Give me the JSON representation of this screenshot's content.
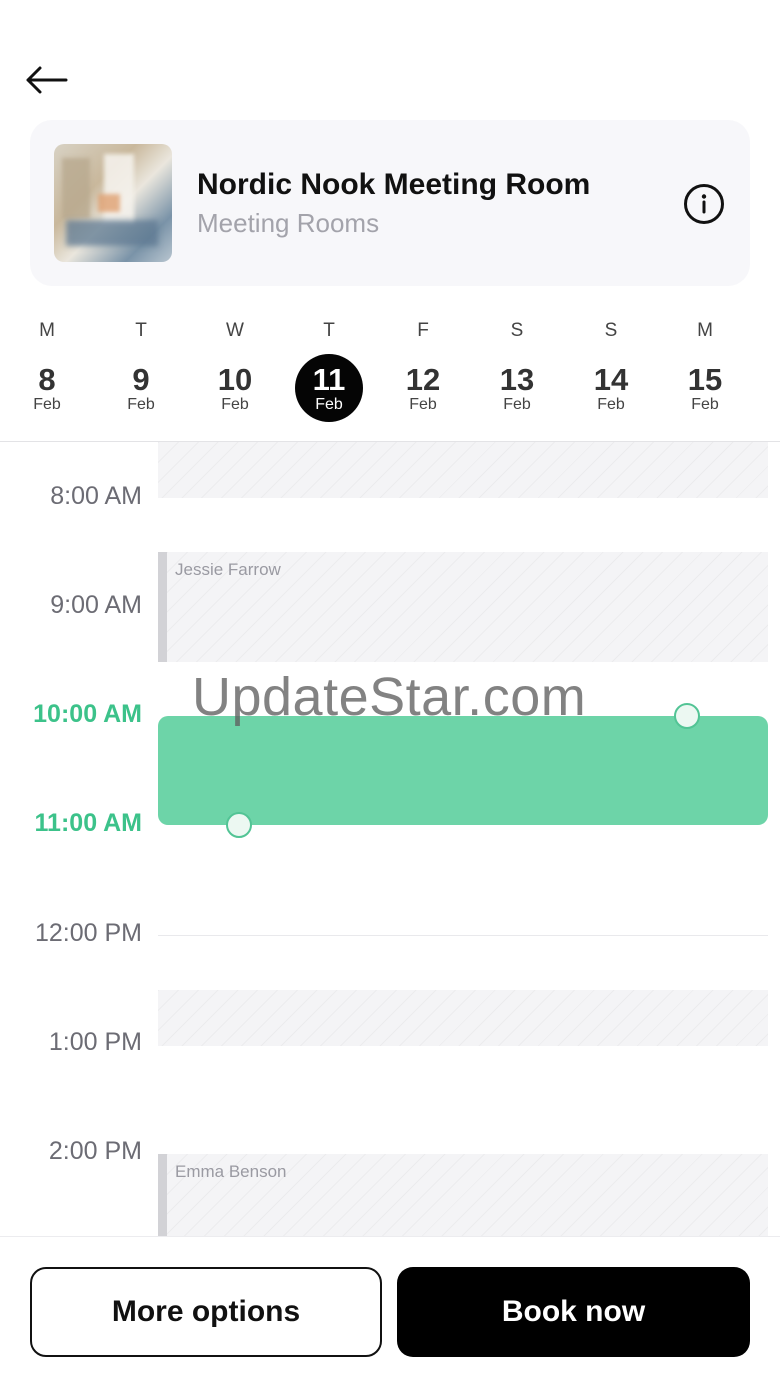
{
  "header": {
    "back_icon": "arrow-left-icon"
  },
  "room": {
    "title": "Nordic Nook Meeting Room",
    "category": "Meeting Rooms",
    "info_icon": "info-circle-icon"
  },
  "week": [
    {
      "dow": "M",
      "day": "8",
      "month": "Feb",
      "selected": false
    },
    {
      "dow": "T",
      "day": "9",
      "month": "Feb",
      "selected": false
    },
    {
      "dow": "W",
      "day": "10",
      "month": "Feb",
      "selected": false
    },
    {
      "dow": "T",
      "day": "11",
      "month": "Feb",
      "selected": true
    },
    {
      "dow": "F",
      "day": "12",
      "month": "Feb",
      "selected": false
    },
    {
      "dow": "S",
      "day": "13",
      "month": "Feb",
      "selected": false
    },
    {
      "dow": "S",
      "day": "14",
      "month": "Feb",
      "selected": false
    },
    {
      "dow": "M",
      "day": "15",
      "month": "Feb",
      "selected": false
    }
  ],
  "schedule": {
    "times": [
      "8:00 AM",
      "9:00 AM",
      "10:00 AM",
      "11:00 AM",
      "12:00 PM",
      "1:00 PM",
      "2:00 PM"
    ],
    "events": [
      {
        "name": "Jessie Farrow"
      },
      {
        "name": "Emma Benson"
      }
    ],
    "selection": {
      "start": "10:00 AM",
      "end": "11:00 AM",
      "color": "#6dd4a8"
    }
  },
  "watermark": "UpdateStar.com",
  "actions": {
    "more_options_label": "More options",
    "book_now_label": "Book now"
  },
  "colors": {
    "accent": "#3cc28a",
    "selected_day": "#000000",
    "primary_button": "#000000"
  }
}
